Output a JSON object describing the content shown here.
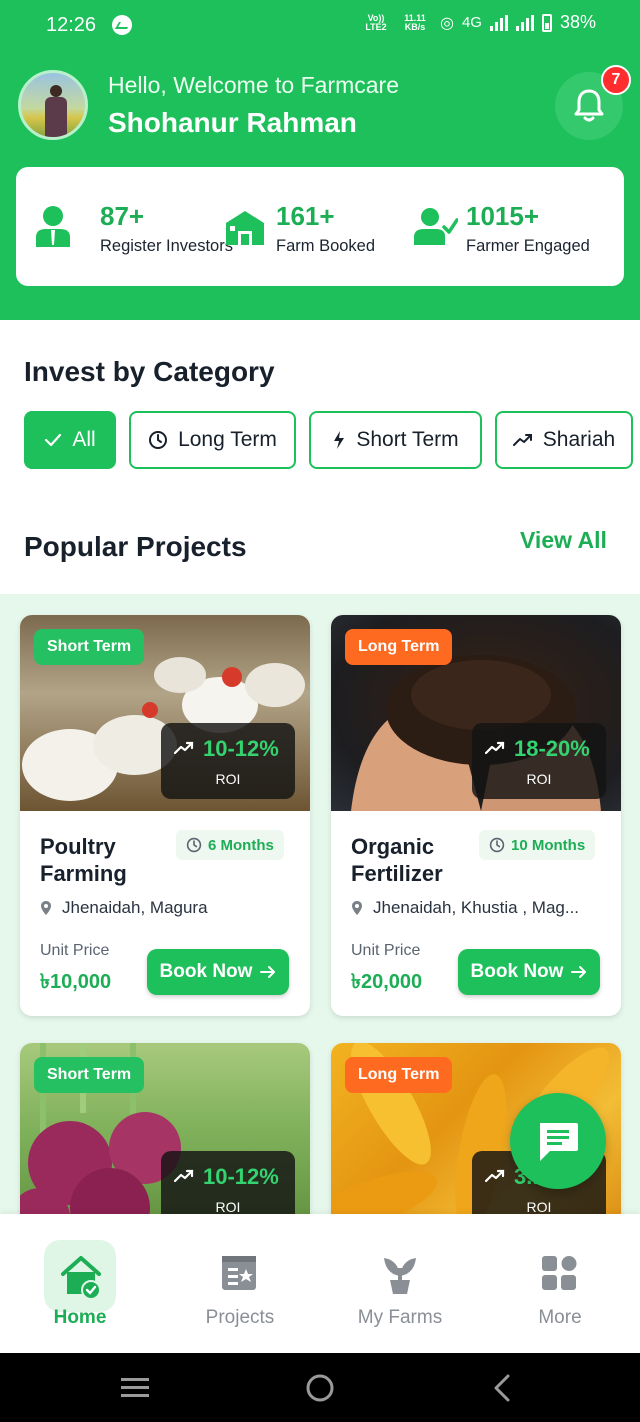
{
  "status_bar": {
    "time": "12:26",
    "net_top": "Vo)) LTE2",
    "speed": "11.11 KB/s",
    "network": "4G",
    "battery": "38%"
  },
  "header": {
    "greeting": "Hello, Welcome to Farmcare",
    "user_name": "Shohanur Rahman",
    "notification_count": "7"
  },
  "stats": [
    {
      "value": "87+",
      "label": "Register Investors",
      "icon": "investor-icon"
    },
    {
      "value": "161+",
      "label": "Farm Booked",
      "icon": "farm-icon"
    },
    {
      "value": "1015+",
      "label": "Farmer Engaged",
      "icon": "farmer-check-icon"
    }
  ],
  "category": {
    "title": "Invest by Category",
    "chips": [
      {
        "label": "All",
        "icon": "check-icon",
        "active": true
      },
      {
        "label": "Long Term",
        "icon": "clock-icon",
        "active": false
      },
      {
        "label": "Short Term",
        "icon": "bolt-icon",
        "active": false
      },
      {
        "label": "Shariah",
        "icon": "trend-icon",
        "active": false
      }
    ]
  },
  "popular": {
    "title": "Popular Projects",
    "view_all": "View All",
    "projects": [
      {
        "tag": "Short Term",
        "roi": "10-12%",
        "roi_label": "ROI",
        "title": "Poultry Farming",
        "duration": "6 Months",
        "location": "Jhenaidah, Magura",
        "unit_price_label": "Unit Price",
        "price": "৳10,000",
        "book_label": "Book Now"
      },
      {
        "tag": "Long Term",
        "roi": "18-20%",
        "roi_label": "ROI",
        "title": "Organic Fertilizer",
        "duration": "10 Months",
        "location": "Jhenaidah, Khustia , Mag...",
        "unit_price_label": "Unit Price",
        "price": "৳20,000",
        "book_label": "Book Now"
      },
      {
        "tag": "Short Term",
        "roi": "10-12%",
        "roi_label": "ROI"
      },
      {
        "tag": "Long Term",
        "roi": "3...%",
        "roi_label": "ROI"
      }
    ]
  },
  "bottom_nav": [
    {
      "label": "Home",
      "icon": "home-icon",
      "active": true
    },
    {
      "label": "Projects",
      "icon": "projects-icon",
      "active": false
    },
    {
      "label": "My Farms",
      "icon": "plant-icon",
      "active": false
    },
    {
      "label": "More",
      "icon": "grid-icon",
      "active": false
    }
  ],
  "colors": {
    "brand": "#1dc05a",
    "brand_text": "#1dae55",
    "long_term": "#ff6a21",
    "badge": "#ff2d2d"
  }
}
